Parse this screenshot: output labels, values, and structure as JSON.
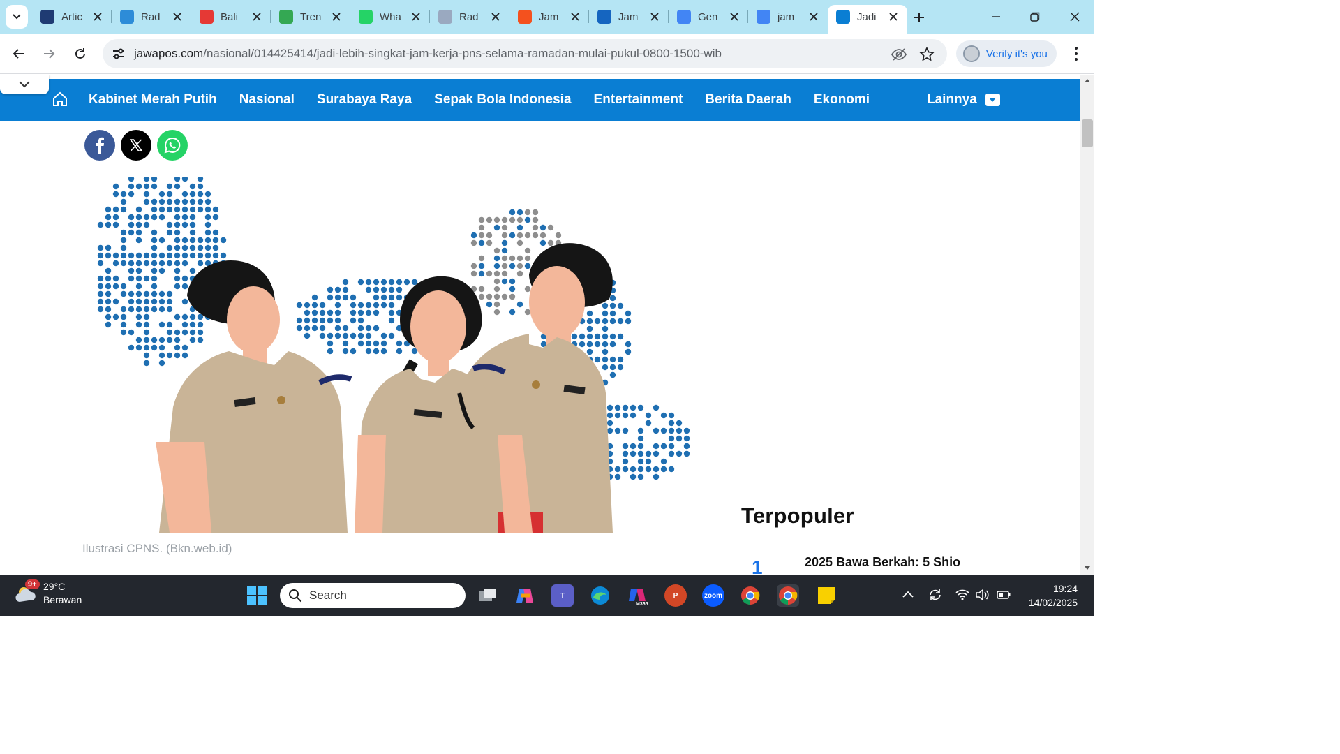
{
  "tabs": [
    {
      "title": "Artic",
      "icon": "ro-icon",
      "color": "#1f3b73"
    },
    {
      "title": "Rad",
      "icon": "b-blue-icon",
      "color": "#2d8cd8"
    },
    {
      "title": "Bali",
      "icon": "b-red-icon",
      "color": "#e53935"
    },
    {
      "title": "Tren",
      "icon": "trend-icon",
      "color": "#34a853"
    },
    {
      "title": "Wha",
      "icon": "whatsapp-icon",
      "color": "#25d366"
    },
    {
      "title": "Rad",
      "icon": "r-icon",
      "color": "#9aa9c0"
    },
    {
      "title": "Jam",
      "icon": "six-icon",
      "color": "#f4511e"
    },
    {
      "title": "Jam",
      "icon": "t-icon",
      "color": "#1565c0"
    },
    {
      "title": "Gen",
      "icon": "gemini-icon",
      "color": "#4285f4"
    },
    {
      "title": "jam",
      "icon": "google-icon",
      "color": "#4285f4"
    },
    {
      "title": "Jadi",
      "icon": "jp-icon",
      "color": "#0a7ed3",
      "active": true
    }
  ],
  "toolbar": {
    "url_host": "jawapos.com",
    "url_path": "/nasional/014425414/jadi-lebih-singkat-jam-kerja-pns-selama-ramadan-mulai-pukul-0800-1500-wib",
    "verify_label": "Verify it's you"
  },
  "site_nav": {
    "items": [
      "Kabinet Merah Putih",
      "Nasional",
      "Surabaya Raya",
      "Sepak Bola Indonesia",
      "Entertainment",
      "Berita Daerah",
      "Ekonomi"
    ],
    "more_label": "Lainnya",
    "color": "#0a7ed3"
  },
  "article": {
    "caption": "Ilustrasi CPNS. (Bkn.web.id)"
  },
  "sidebar": {
    "heading": "Terpopuler",
    "first_number": "1",
    "first_item": "2025 Bawa Berkah: 5 Shio"
  },
  "taskbar": {
    "weather_temp": "29°C",
    "weather_desc": "Berawan",
    "weather_badge": "9+",
    "search_placeholder": "Search",
    "time": "19:24",
    "date": "14/02/2025"
  }
}
